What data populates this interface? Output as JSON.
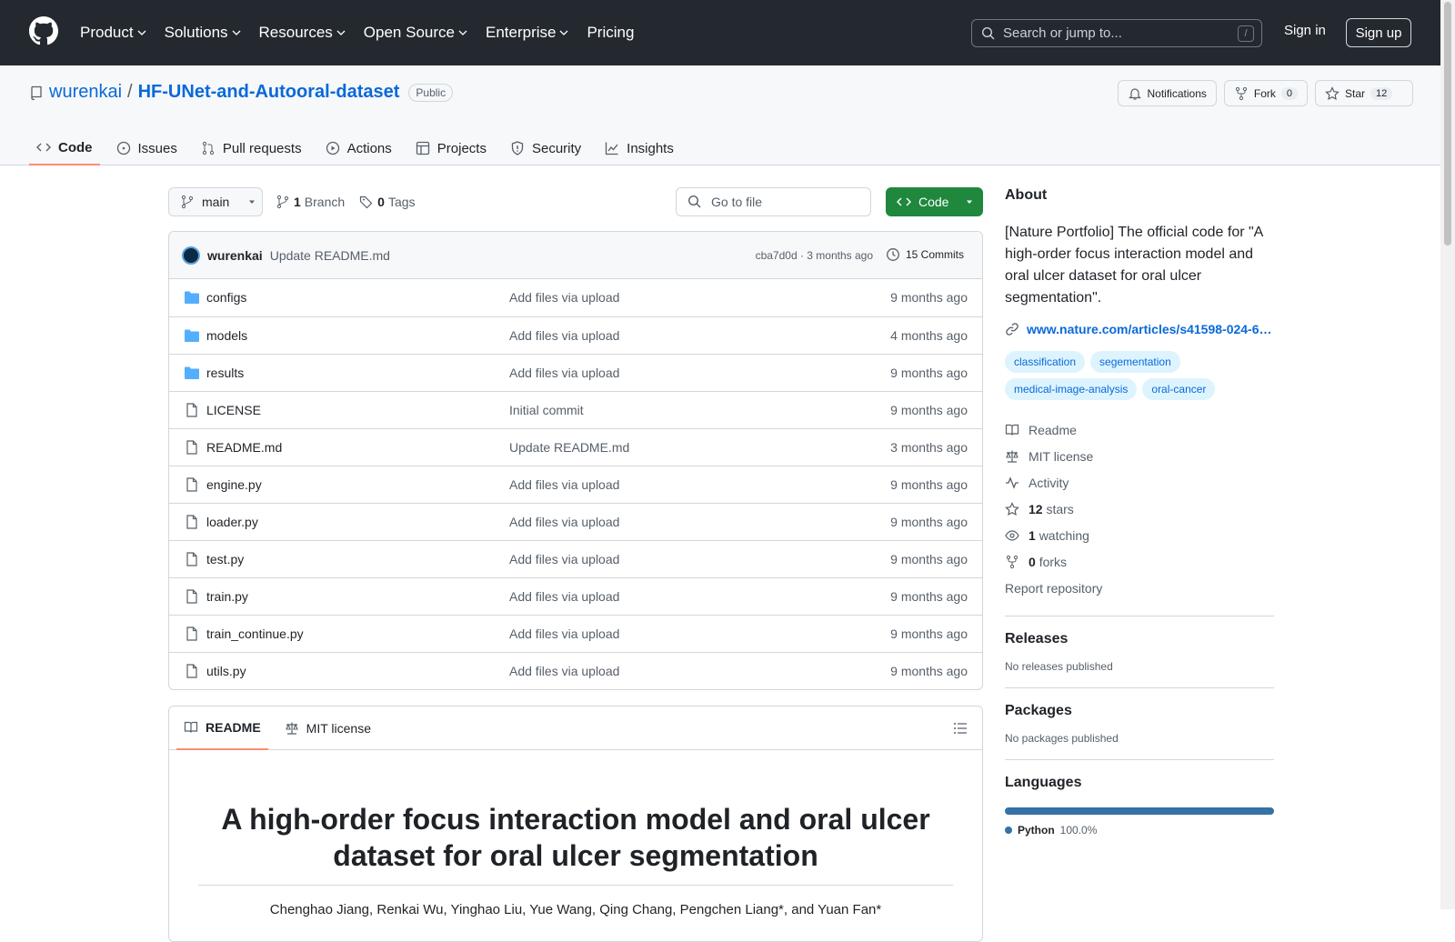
{
  "header": {
    "nav": [
      "Product",
      "Solutions",
      "Resources",
      "Open Source",
      "Enterprise",
      "Pricing"
    ],
    "search_placeholder": "Search or jump to...",
    "search_kbd": "/",
    "signin": "Sign in",
    "signup": "Sign up"
  },
  "repo": {
    "owner": "wurenkai",
    "separator": "/",
    "name": "HF-UNet-and-Autooral-dataset",
    "visibility": "Public",
    "notifications": "Notifications",
    "fork_label": "Fork",
    "fork_count": "0",
    "star_label": "Star",
    "star_count": "12"
  },
  "tabs": [
    "Code",
    "Issues",
    "Pull requests",
    "Actions",
    "Projects",
    "Security",
    "Insights"
  ],
  "toolbar": {
    "branch": "main",
    "branch_count": "1",
    "branch_label": "Branch",
    "tag_count": "0",
    "tag_label": "Tags",
    "goto_placeholder": "Go to file",
    "code_label": "Code"
  },
  "commit": {
    "author": "wurenkai",
    "message": "Update README.md",
    "meta": "cba7d0d · 3 months ago",
    "count": "15 Commits"
  },
  "files": [
    {
      "name": "configs",
      "type": "dir",
      "message": "Add files via upload",
      "time": "9 months ago"
    },
    {
      "name": "models",
      "type": "dir",
      "message": "Add files via upload",
      "time": "4 months ago"
    },
    {
      "name": "results",
      "type": "dir",
      "message": "Add files via upload",
      "time": "9 months ago"
    },
    {
      "name": "LICENSE",
      "type": "file",
      "message": "Initial commit",
      "time": "9 months ago"
    },
    {
      "name": "README.md",
      "type": "file",
      "message": "Update README.md",
      "time": "3 months ago"
    },
    {
      "name": "engine.py",
      "type": "file",
      "message": "Add files via upload",
      "time": "9 months ago"
    },
    {
      "name": "loader.py",
      "type": "file",
      "message": "Add files via upload",
      "time": "9 months ago"
    },
    {
      "name": "test.py",
      "type": "file",
      "message": "Add files via upload",
      "time": "9 months ago"
    },
    {
      "name": "train.py",
      "type": "file",
      "message": "Add files via upload",
      "time": "9 months ago"
    },
    {
      "name": "train_continue.py",
      "type": "file",
      "message": "Add files via upload",
      "time": "9 months ago"
    },
    {
      "name": "utils.py",
      "type": "file",
      "message": "Add files via upload",
      "time": "9 months ago"
    }
  ],
  "readme": {
    "tab_readme": "README",
    "tab_license": "MIT license",
    "title": "A high-order focus interaction model and oral ulcer dataset for oral ulcer segmentation",
    "authors": "Chenghao Jiang, Renkai Wu, Yinghao Liu, Yue Wang, Qing Chang, Pengchen Liang*, and Yuan Fan*"
  },
  "about": {
    "heading": "About",
    "description": "[Nature Portfolio] The official code for \"A high-order focus interaction model and oral ulcer dataset for oral ulcer segmentation\".",
    "link": "www.nature.com/articles/s41598-024-6…",
    "topics": [
      "classification",
      "segementation",
      "medical-image-analysis",
      "oral-cancer"
    ],
    "readme": "Readme",
    "license": "MIT license",
    "activity": "Activity",
    "stars_count": "12",
    "stars_label": "stars",
    "watching_count": "1",
    "watching_label": "watching",
    "forks_count": "0",
    "forks_label": "forks",
    "report": "Report repository"
  },
  "releases": {
    "heading": "Releases",
    "text": "No releases published"
  },
  "packages": {
    "heading": "Packages",
    "text": "No packages published"
  },
  "languages": {
    "heading": "Languages",
    "name": "Python",
    "percent": "100.0%",
    "fraction": 1.0,
    "color": "#3572A5"
  }
}
